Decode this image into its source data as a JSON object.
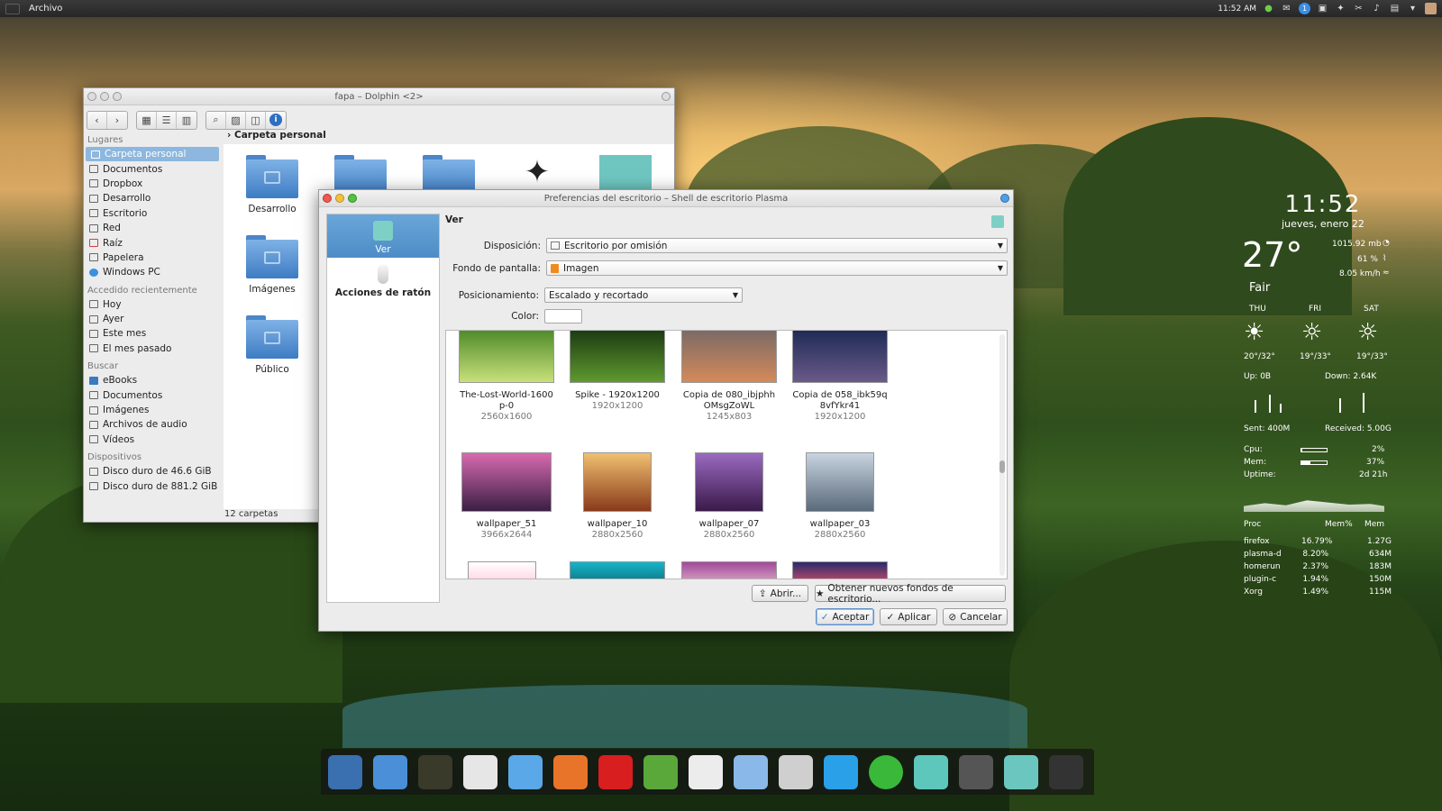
{
  "top_panel": {
    "menu": "Archivo",
    "time": "11:52 AM",
    "notification_count": "1"
  },
  "dolphin": {
    "title": "fapa – Dolphin <2>",
    "breadcrumb": "Carpeta personal",
    "status": "12 carpetas",
    "places_sections": [
      {
        "label": "Lugares",
        "items": [
          "Carpeta personal",
          "Documentos",
          "Dropbox",
          "Desarrollo",
          "Escritorio",
          "Red",
          "Raíz",
          "Papelera",
          "Windows PC"
        ]
      },
      {
        "label": "Accedido recientemente",
        "items": [
          "Hoy",
          "Ayer",
          "Este mes",
          "El mes pasado"
        ]
      },
      {
        "label": "Buscar",
        "items": [
          "eBooks",
          "Documentos",
          "Imágenes",
          "Archivos de audio",
          "Vídeos"
        ]
      },
      {
        "label": "Dispositivos",
        "items": [
          "Disco duro de 46.6 GiB",
          "Disco duro de 881.2 GiB"
        ]
      }
    ],
    "folders": [
      "Desarrollo",
      "Imágenes",
      "Público"
    ]
  },
  "prefs": {
    "title": "Preferencias del escritorio – Shell de escritorio Plasma",
    "categories": [
      "Ver",
      "Acciones de ratón"
    ],
    "section_title": "Ver",
    "layout_label": "Disposición:",
    "layout_value": "Escritorio por omisión",
    "wallpaper_label": "Fondo de pantalla:",
    "wallpaper_value": "Imagen",
    "position_label": "Posicionamiento:",
    "position_value": "Escalado y recortado",
    "color_label": "Color:",
    "wallpapers": [
      {
        "name": "The-Lost-World-1600p-0",
        "dim": "2560x1600",
        "c1": "#4f8a2a",
        "c2": "#c8e07a"
      },
      {
        "name": "Spike - 1920x1200",
        "dim": "1920x1200",
        "c1": "#1c3a12",
        "c2": "#5f9a2f"
      },
      {
        "name": "Copia de 080_ibjphhOMsgZoWL",
        "dim": "1245x803",
        "c1": "#7a6a66",
        "c2": "#d48a5a"
      },
      {
        "name": "Copia de 058_ibk59q8vfYkr41",
        "dim": "1920x1200",
        "c1": "#1e2a55",
        "c2": "#6a5a8a"
      },
      {
        "name": "wallpaper_51",
        "dim": "3966x2644",
        "c1": "#d86ab0",
        "c2": "#3a1f44"
      },
      {
        "name": "wallpaper_10",
        "dim": "2880x2560",
        "c1": "#f0c070",
        "c2": "#8a3a1a"
      },
      {
        "name": "wallpaper_07",
        "dim": "2880x2560",
        "c1": "#9a6ac0",
        "c2": "#3a1a4a"
      },
      {
        "name": "wallpaper_03",
        "dim": "2880x2560",
        "c1": "#c8d4e0",
        "c2": "#5a6a7a"
      }
    ],
    "btn_open": "Abrir...",
    "btn_get_new": "Obtener nuevos fondos de escritorio...",
    "btn_ok": "Aceptar",
    "btn_apply": "Aplicar",
    "btn_cancel": "Cancelar"
  },
  "clock_widget": {
    "time": "11:52",
    "date": "jueves, enero 22"
  },
  "weather": {
    "temp": "27°",
    "condition": "Fair",
    "pressure": "1015.92 mb",
    "humidity": "61 %",
    "wind": "8.05 km/h",
    "days": [
      {
        "name": "THU",
        "range": "20°/32°"
      },
      {
        "name": "FRI",
        "range": "19°/33°"
      },
      {
        "name": "SAT",
        "range": "19°/33°"
      }
    ]
  },
  "network": {
    "up": "Up: 0B",
    "down": "Down: 2.64K",
    "sent": "Sent: 400M",
    "received": "Received: 5.00G"
  },
  "system": {
    "cpu_label": "Cpu:",
    "cpu": "2%",
    "cpu_level": 0.02,
    "mem_label": "Mem:",
    "mem": "37%",
    "mem_level": 0.37,
    "uptime_label": "Uptime:",
    "uptime": "2d 21h",
    "proc_headers": [
      "Proc",
      "Mem%",
      "Mem"
    ],
    "procs": [
      [
        "firefox",
        "16.79%",
        "1.27G"
      ],
      [
        "plasma-d",
        "8.20%",
        "634M"
      ],
      [
        "homerun",
        "2.37%",
        "183M"
      ],
      [
        "plugin-c",
        "1.94%",
        "150M"
      ],
      [
        "Xorg",
        "1.49%",
        "115M"
      ]
    ]
  },
  "dock_icons": [
    "finder-icon",
    "folder-icon",
    "monitor-icon",
    "download-icon",
    "document-icon",
    "firefox-icon",
    "youtube-icon",
    "evernote-icon",
    "reader-icon",
    "box-icon",
    "wolf-icon",
    "twitter-icon",
    "spotify-icon",
    "dolphin-icon",
    "users-icon",
    "desktop-icon",
    "settings-icon"
  ],
  "colors": {
    "selection": "#8db7de",
    "accent": "#4d8cc7"
  }
}
